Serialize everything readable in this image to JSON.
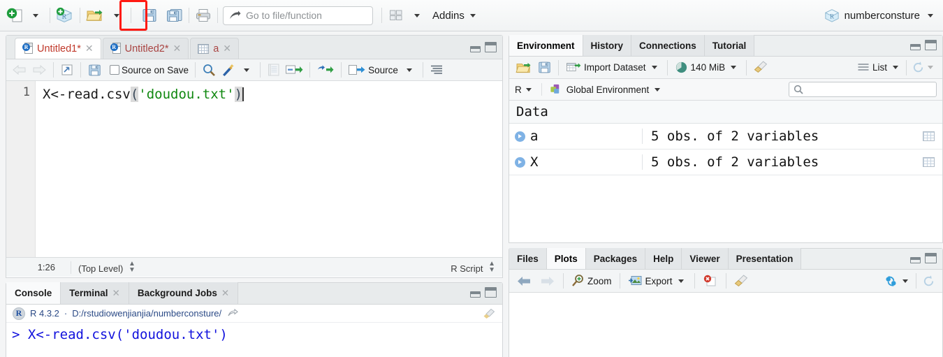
{
  "toolbar": {
    "new_file_icon": "new-file-icon",
    "new_project_icon": "new-project-icon",
    "open_icon": "open-file-icon",
    "save_icon": "save-icon",
    "save_all_icon": "save-all-icon",
    "print_icon": "print-icon",
    "goto_placeholder": "Go to file/function",
    "goto_value": "",
    "panes_icon": "pane-layout-icon",
    "addins_label": "Addins",
    "project_name": "numberconsture"
  },
  "source": {
    "tabs": [
      {
        "label": "Untitled1*",
        "icon": "r-document-icon",
        "closable": true,
        "active": true
      },
      {
        "label": "Untitled2*",
        "icon": "r-document-icon",
        "closable": true,
        "active": false
      },
      {
        "label": "a",
        "icon": "data-grid-icon",
        "closable": true,
        "active": false
      }
    ],
    "toolbar": {
      "back_icon": "back-arrow-icon",
      "forward_icon": "forward-arrow-icon",
      "popout_icon": "show-in-new-window-icon",
      "save_icon": "save-icon",
      "source_on_save_label": "Source on Save",
      "source_on_save_checked": false,
      "find_icon": "search-icon",
      "magic_icon": "code-tools-icon",
      "compile_report_icon": "compile-report-icon",
      "run_icon": "run-icon",
      "rerun_icon": "re-run-icon",
      "source_label": "Source",
      "outline_icon": "document-outline-icon"
    },
    "editor": {
      "line_number": "1",
      "code_prefix": "X<-read.csv",
      "open_paren": "(",
      "code_string": "'doudou.txt'",
      "close_paren": ")"
    },
    "status": {
      "position": "1:26",
      "scope": "(Top Level)",
      "file_type": "R Script"
    }
  },
  "console": {
    "tabs": [
      {
        "label": "Console",
        "closable": false,
        "active": true
      },
      {
        "label": "Terminal",
        "closable": true,
        "active": false
      },
      {
        "label": "Background Jobs",
        "closable": true,
        "active": false
      }
    ],
    "version": "R 4.3.2",
    "separator": "·",
    "working_dir": "D:/rstudiowenjianjia/numberconsture/",
    "broom_icon": "clear-console-icon",
    "prompt_line": "> X<-read.csv('doudou.txt')"
  },
  "environment": {
    "tabs": [
      {
        "label": "Environment",
        "active": true
      },
      {
        "label": "History",
        "active": false
      },
      {
        "label": "Connections",
        "active": false
      },
      {
        "label": "Tutorial",
        "active": false
      }
    ],
    "toolbar": {
      "open_icon": "load-workspace-icon",
      "save_icon": "save-workspace-icon",
      "import_label": "Import Dataset",
      "memory_label": "140 MiB",
      "memory_icon": "memory-usage-icon",
      "broom_icon": "clear-environment-icon",
      "view_mode_label": "List",
      "view_mode_icon": "list-view-icon",
      "refresh_icon": "refresh-icon"
    },
    "scope": {
      "language": "R",
      "environment_label": "Global Environment",
      "environment_icon": "global-environment-icon",
      "search_placeholder": "",
      "search_value": ""
    },
    "section_label": "Data",
    "items": [
      {
        "name": "a",
        "value": "5 obs. of 2 variables",
        "expander": "expand-icon",
        "view_icon": "view-table-icon"
      },
      {
        "name": "X",
        "value": "5 obs. of 2 variables",
        "expander": "expand-icon",
        "view_icon": "view-table-icon"
      }
    ]
  },
  "plots": {
    "tabs": [
      {
        "label": "Files",
        "active": false
      },
      {
        "label": "Plots",
        "active": true
      },
      {
        "label": "Packages",
        "active": false
      },
      {
        "label": "Help",
        "active": false
      },
      {
        "label": "Viewer",
        "active": false
      },
      {
        "label": "Presentation",
        "active": false
      }
    ],
    "toolbar": {
      "back_icon": "previous-plot-icon",
      "forward_icon": "next-plot-icon",
      "zoom_label": "Zoom",
      "zoom_icon": "zoom-icon",
      "export_label": "Export",
      "export_icon": "export-icon",
      "remove_icon": "remove-plot-icon",
      "clear_icon": "clear-plots-icon",
      "publish_icon": "publish-icon",
      "refresh_icon": "refresh-icon"
    }
  },
  "colors": {
    "accent_red": "#ff1a13",
    "console_blue": "#1111dd",
    "string_green": "#108810",
    "tab_red": "#c0392b"
  }
}
